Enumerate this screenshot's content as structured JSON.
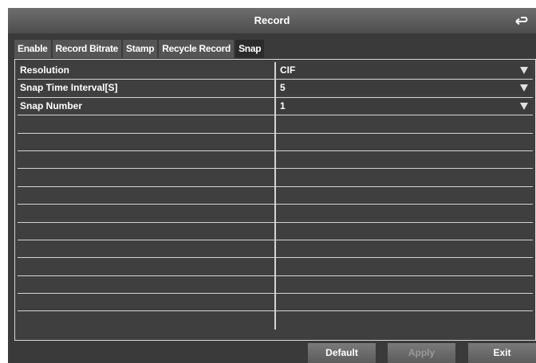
{
  "window": {
    "title": "Record"
  },
  "tabs": [
    {
      "label": "Enable"
    },
    {
      "label": "Record Bitrate"
    },
    {
      "label": "Stamp"
    },
    {
      "label": "Recycle Record"
    },
    {
      "label": "Snap",
      "active": true
    }
  ],
  "settings": {
    "resolution": {
      "label": "Resolution",
      "value": "CIF"
    },
    "snap_interval": {
      "label": "Snap Time Interval[S]",
      "value": "5"
    },
    "snap_number": {
      "label": "Snap Number",
      "value": "1"
    }
  },
  "buttons": {
    "default": "Default",
    "apply": "Apply",
    "exit": "Exit"
  },
  "colors": {
    "window_bg": "#3a3a3a",
    "grid_lines": "#d4d4d4",
    "text": "#ffffff"
  },
  "icons": {
    "back": "return-arrow-icon",
    "dropdown": "triangle-down-icon"
  }
}
